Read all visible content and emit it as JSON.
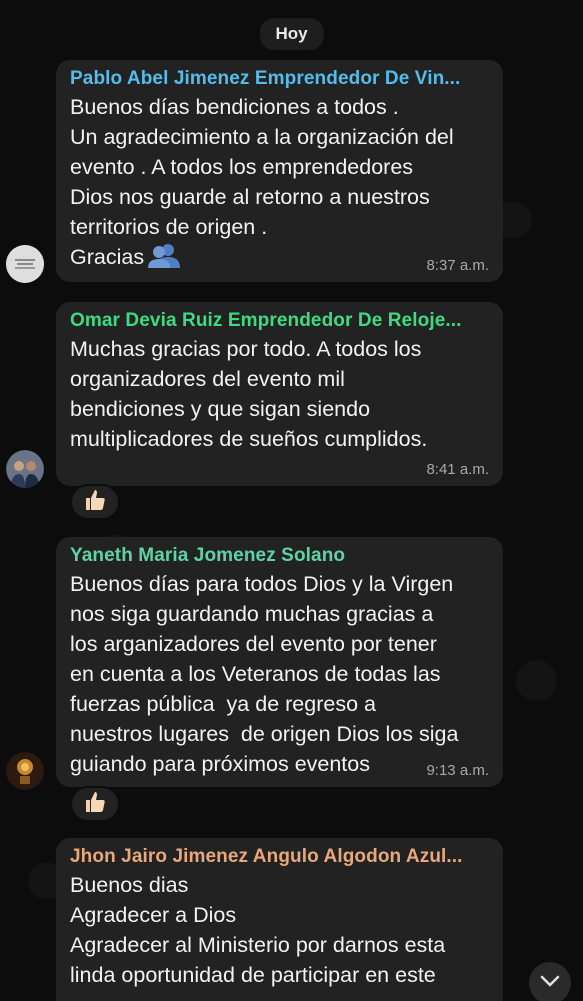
{
  "date_label": "Hoy",
  "messages": [
    {
      "sender": "Pablo Abel Jimenez Emprendedor De Vin...",
      "sender_color": "#53bdeb",
      "lines": [
        "Buenos días bendiciones a todos .",
        "Un agradecimiento a la organización del",
        "evento . A todos los emprendedores",
        "Dios nos guarde al retorno a nuestros",
        "territorios de origen .",
        "Gracias"
      ],
      "time": "8:37 a.m.",
      "emoji": "people-emoji-icon"
    },
    {
      "sender": "Omar Devia Ruiz Emprendedor De Reloje...",
      "sender_color": "#3ddc84",
      "lines": [
        "Muchas gracias por todo. A todos los",
        "organizadores del evento mil",
        "bendiciones y que sigan siendo",
        "multiplicadores de sueños cumplidos."
      ],
      "time": "8:41 a.m.",
      "reaction": "thumbs-up-icon"
    },
    {
      "sender": "Yaneth Maria Jomenez Solano",
      "sender_color": "#5fd3a6",
      "lines": [
        "Buenos días para todos Dios y la Virgen",
        "nos siga guardando muchas gracias a",
        "los arganizadores del evento por tener",
        "en cuenta a los Veteranos de todas las",
        "fuerzas pública  ya de regreso a",
        "nuestros lugares  de origen Dios los siga",
        "guiando para próximos eventos"
      ],
      "time": "9:13 a.m.",
      "reaction": "thumbs-up-icon"
    },
    {
      "sender": "Jhon Jairo Jimenez Angulo Algodon Azul...",
      "sender_color": "#e8a87c",
      "lines": [
        "Buenos dias",
        "Agradecer a Dios",
        "Agradecer al Ministerio por darnos esta",
        "linda oportunidad de participar en este"
      ]
    }
  ]
}
